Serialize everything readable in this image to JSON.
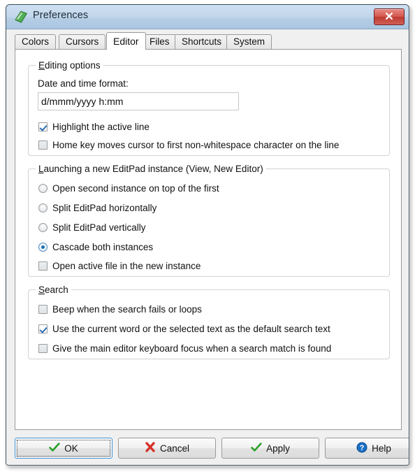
{
  "window": {
    "title": "Preferences",
    "app_icon": "green-book-icon",
    "close_label": "Close",
    "close_icon": "close-x-icon"
  },
  "tabs": [
    {
      "label": "Colors",
      "active": false
    },
    {
      "label": "Cursors",
      "active": false
    },
    {
      "label": "Editor",
      "active": true
    },
    {
      "label": "Files",
      "active": false
    },
    {
      "label": "Shortcuts",
      "active": false
    },
    {
      "label": "System",
      "active": false
    }
  ],
  "groups": {
    "editing": {
      "title_accel": "E",
      "title_rest": "diting options",
      "date_format_label": "Date and time format:",
      "date_format_value": "d/mmm/yyyy h:mm",
      "date_format_placeholder": "d/mmm/yyyy h:mm",
      "options": [
        {
          "label": "Highlight the active line",
          "checked": true
        },
        {
          "label": "Home key moves cursor to first non-whitespace character on the line",
          "checked": false
        }
      ]
    },
    "launching": {
      "title_accel": "L",
      "title_rest": "aunching a new EditPad instance (View, New Editor)",
      "radios": [
        {
          "label": "Open second instance on top of the first",
          "selected": false
        },
        {
          "label": "Split EditPad horizontally",
          "selected": false
        },
        {
          "label": "Split EditPad vertically",
          "selected": false
        },
        {
          "label": "Cascade both instances",
          "selected": true
        }
      ],
      "checkbox": {
        "label": "Open active file in the new instance",
        "checked": false
      }
    },
    "search": {
      "title_accel": "S",
      "title_rest": "earch",
      "options": [
        {
          "label": "Beep when the search fails or loops",
          "checked": false
        },
        {
          "label": "Use the current word or the selected text as the default search text",
          "checked": true
        },
        {
          "label": "Give the main editor keyboard focus when a search match is found",
          "checked": false
        }
      ]
    }
  },
  "buttons": [
    {
      "label": "OK",
      "icon": "green-check-icon",
      "focused": true
    },
    {
      "label": "Cancel",
      "icon": "red-x-icon",
      "focused": false
    },
    {
      "label": "Apply",
      "icon": "green-check-icon",
      "focused": false
    },
    {
      "label": "Help",
      "icon": "blue-question-icon",
      "focused": false
    }
  ],
  "colors": {
    "titlebar_top": "#cfe0f2",
    "titlebar_bottom": "#a9c6e2",
    "close_red": "#cf5f55",
    "accent_blue": "#1c6fb0",
    "check_green": "#2aa02a",
    "cancel_red": "#d6322a",
    "help_blue": "#1a6fc4",
    "panel_bg": "#ffffff",
    "dialog_bg": "#f0f0f0"
  }
}
